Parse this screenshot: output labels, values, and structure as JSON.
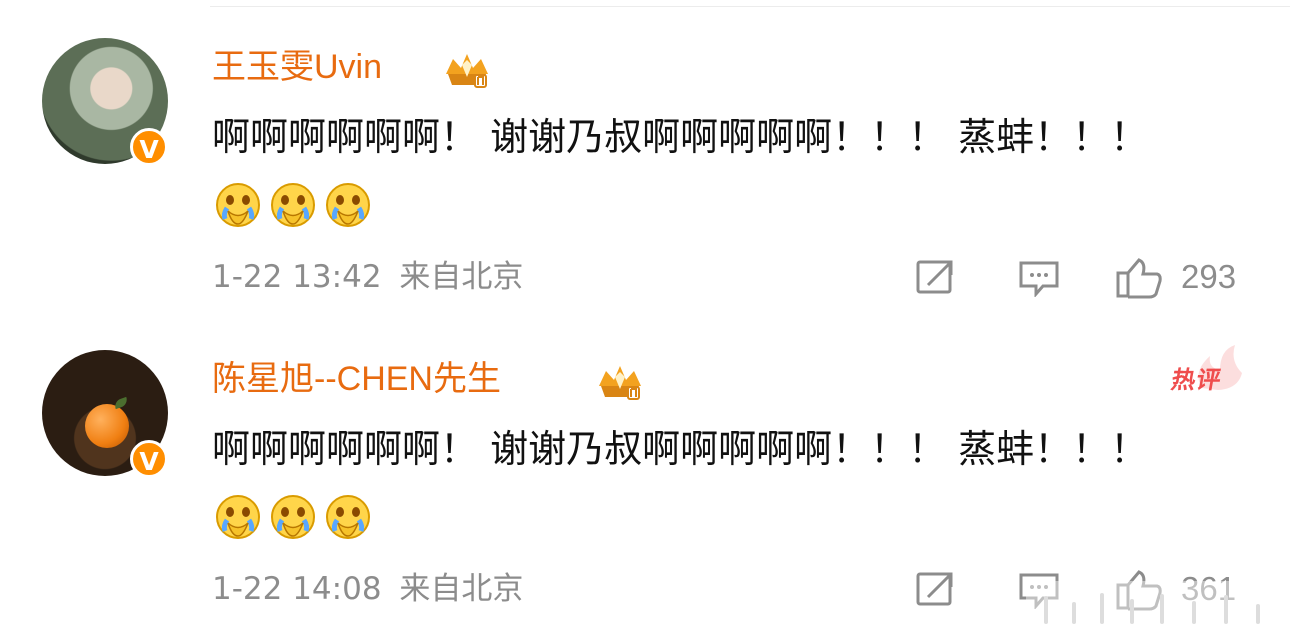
{
  "comments": [
    {
      "name": "王玉雯Uvin",
      "text": "啊啊啊啊啊啊！ 谢谢乃叔啊啊啊啊啊！！！ 蒸蚌！！！",
      "date": "1-22 13:42",
      "location": "来自北京",
      "likes": "293",
      "hot_label": "",
      "icons": [
        "verified-v-icon",
        "crown-badge-icon",
        "crying-face-icon",
        "share-icon",
        "comment-icon",
        "like-icon"
      ]
    },
    {
      "name": "陈星旭--CHEN先生",
      "text": "啊啊啊啊啊啊！ 谢谢乃叔啊啊啊啊啊！！！ 蒸蚌！！！",
      "date": "1-22 14:08",
      "location": "来自北京",
      "likes": "361",
      "hot_label": "热评",
      "icons": [
        "verified-v-icon",
        "crown-badge-icon",
        "crying-face-icon",
        "share-icon",
        "comment-icon",
        "like-icon"
      ]
    }
  ],
  "colors": {
    "username": "#e86b10",
    "text": "#111111",
    "meta": "#8c8c8c",
    "verified": "#ff8e00",
    "hot": "#ef4d4d"
  }
}
